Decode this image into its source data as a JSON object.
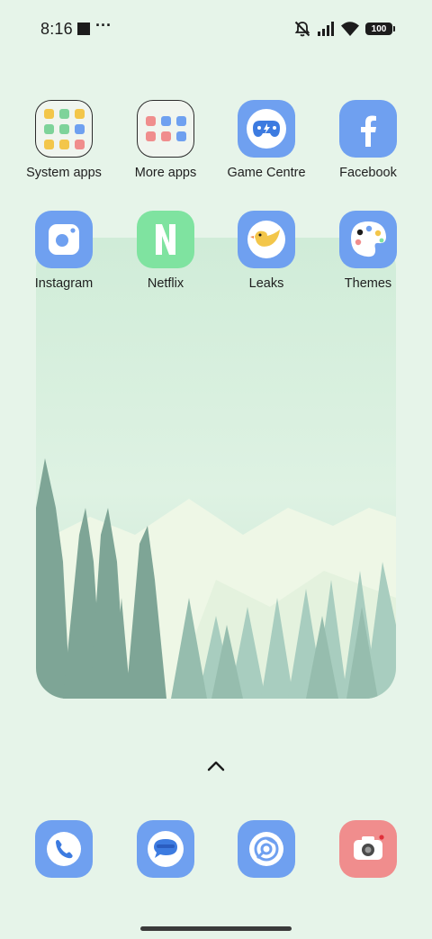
{
  "status_bar": {
    "time": "8:16",
    "overflow": "···",
    "battery": "100",
    "icons": [
      "notifications-muted-icon",
      "cellular-signal-icon",
      "wifi-icon",
      "battery-icon"
    ]
  },
  "apps": [
    {
      "label": "System apps",
      "type": "folder"
    },
    {
      "label": "More apps",
      "type": "folder"
    },
    {
      "label": "Game Centre",
      "icon": "game-controller-icon"
    },
    {
      "label": "Facebook",
      "icon": "facebook-icon"
    },
    {
      "label": "Instagram",
      "icon": "camera-icon"
    },
    {
      "label": "Netflix",
      "icon": "netflix-icon"
    },
    {
      "label": "Leaks",
      "icon": "bird-icon"
    },
    {
      "label": "Themes",
      "icon": "palette-icon"
    }
  ],
  "dock": [
    {
      "icon": "phone-icon"
    },
    {
      "icon": "messages-icon"
    },
    {
      "icon": "chrome-icon"
    },
    {
      "icon": "camera-icon"
    }
  ],
  "colors": {
    "background": "#e6f4e9",
    "icon_blue": "#6fa0f0",
    "netflix_green": "#7fe3a0",
    "camera_red": "#f08d8d"
  }
}
